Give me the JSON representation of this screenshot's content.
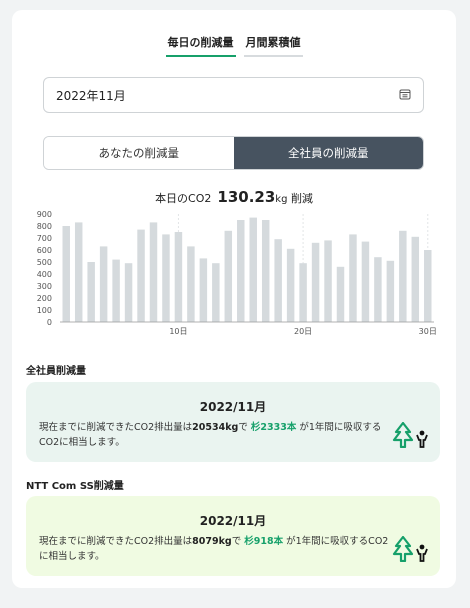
{
  "tabs": {
    "daily": "毎日の削減量",
    "monthly": "月間累積値"
  },
  "month_picker": {
    "value": "2022年11月",
    "icon": "calendar-icon"
  },
  "segment": {
    "yours": "あなたの削減量",
    "company": "全社員の削減量"
  },
  "today": {
    "prefix": "本日のCO2",
    "value": "130.23",
    "unit": "kg",
    "suffix": "削減"
  },
  "chart_data": {
    "type": "bar",
    "x": [
      1,
      2,
      3,
      4,
      5,
      6,
      7,
      8,
      9,
      10,
      11,
      12,
      13,
      14,
      15,
      16,
      17,
      18,
      19,
      20,
      21,
      22,
      23,
      24,
      25,
      26,
      27,
      28,
      29,
      30
    ],
    "values": [
      800,
      830,
      500,
      630,
      520,
      490,
      770,
      830,
      730,
      750,
      630,
      530,
      490,
      760,
      850,
      870,
      850,
      690,
      610,
      490,
      660,
      680,
      460,
      730,
      670,
      540,
      510,
      760,
      710,
      600
    ],
    "ylim": [
      0,
      900
    ],
    "yticks": [
      "900",
      "800",
      "700",
      "600",
      "500",
      "400",
      "300",
      "200",
      "100",
      "0"
    ],
    "xticks": [
      {
        "x": 10,
        "label": "10日"
      },
      {
        "x": 20,
        "label": "20日"
      },
      {
        "x": 30,
        "label": "30日"
      }
    ],
    "grid": true,
    "bar_color": "#d5dadd"
  },
  "all_staff": {
    "title": "全社員削減量",
    "date": "2022/11月",
    "text1": "現在までに削減できたCO2排出量は",
    "amount": "20534kg",
    "text2": "で",
    "trees": "杉2333本",
    "text3": "が1年間に吸収するCO2に相当します。",
    "bg": "#eaf4f0"
  },
  "ntt": {
    "title": "NTT Com SS削減量",
    "date": "2022/11月",
    "text1": "現在までに削減できたCO2排出量は",
    "amount": "8079kg",
    "text2": "で",
    "trees": "杉918本",
    "text3": "が1年間に吸収するCO2に相当します。",
    "bg": "#f0fbe2"
  }
}
